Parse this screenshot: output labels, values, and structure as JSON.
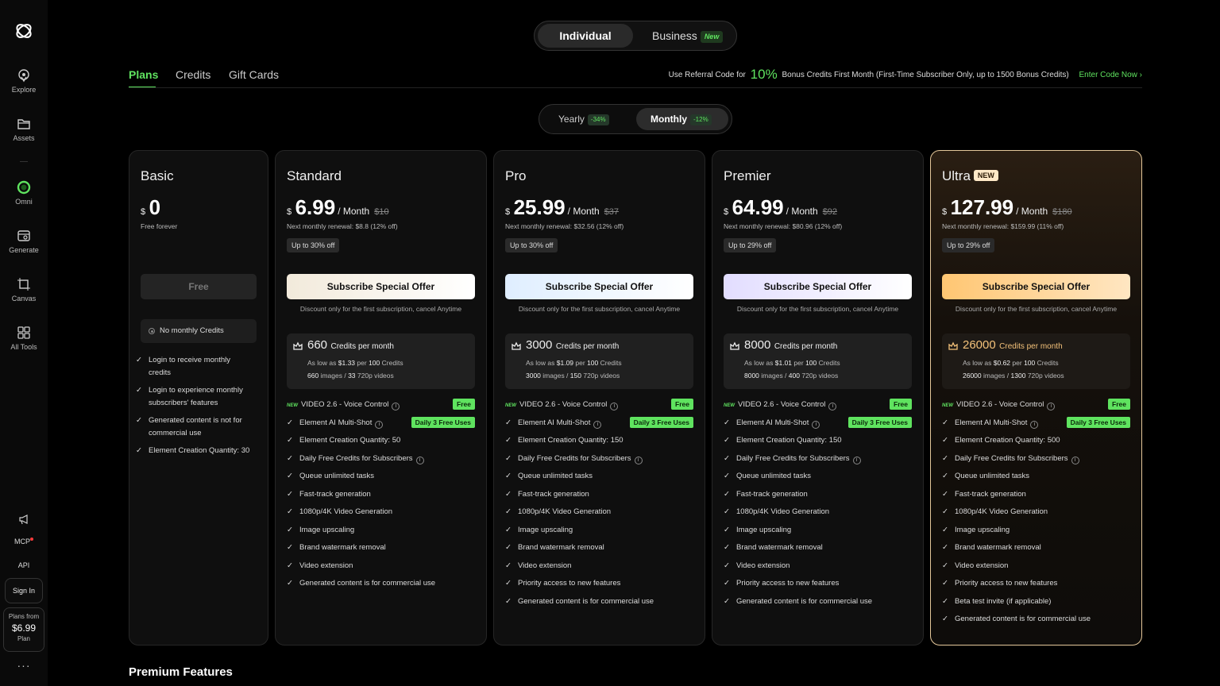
{
  "sidebar": {
    "items": [
      {
        "label": "Explore",
        "icon": "explore-icon"
      },
      {
        "label": "Assets",
        "icon": "folder-icon"
      },
      {
        "label": "Omni",
        "icon": "omni-icon"
      },
      {
        "label": "Generate",
        "icon": "generate-icon"
      },
      {
        "label": "Canvas",
        "icon": "canvas-icon"
      },
      {
        "label": "All Tools",
        "icon": "grid-icon"
      }
    ],
    "mcp": "MCP",
    "api": "API",
    "sign_in": "Sign In",
    "plans_from": {
      "label": "Plans from",
      "price": "$6.99",
      "suffix": "Plan"
    },
    "more": "···"
  },
  "top_switch": {
    "individual": "Individual",
    "business": "Business",
    "new_badge": "New"
  },
  "tabs": [
    "Plans",
    "Credits",
    "Gift Cards"
  ],
  "referral": {
    "prefix": "Use Referral Code for",
    "percent": "10%",
    "suffix": "Bonus Credits First Month (First-Time Subscriber Only, up to 1500 Bonus Credits)",
    "link": "Enter Code Now"
  },
  "billing": {
    "yearly": "Yearly",
    "yearly_badge": "-34%",
    "monthly": "Monthly",
    "monthly_badge": "-12%"
  },
  "cta_note": "Discount only for the first subscription, cancel Anytime",
  "basic": {
    "name": "Basic",
    "currency": "$",
    "price": "0",
    "sub": "Free forever",
    "button": "Free",
    "no_monthly": "No monthly Credits",
    "features": [
      "Login to receive monthly credits",
      "Login to experience monthly subscribers' features",
      "Generated content is not for commercial use",
      "Element Creation Quantity: 30"
    ]
  },
  "plans": [
    {
      "name": "Standard",
      "currency": "$",
      "price": "6.99",
      "unit": "/ Month",
      "old": "$10",
      "renewal": "Next monthly renewal: $8.8 (12% off)",
      "off": "Up to 30% off",
      "button": "Subscribe Special Offer",
      "credits": "660",
      "credits_label": "Credits per month",
      "as_low_as": "As low as",
      "per_price": "$1.33",
      "per": "per",
      "per_qty": "100",
      "per_unit": "Credits",
      "images": "660",
      "images_label": "images /",
      "videos": "33",
      "videos_label": "720p videos",
      "features": [
        {
          "text": "VIDEO 2.6 - Voice Control",
          "new": "NEW",
          "info": true,
          "badge": "Free"
        },
        {
          "text": "Element AI Multi-Shot",
          "info": true,
          "badge": "Daily 3 Free Uses"
        },
        {
          "text": "Element Creation Quantity: 50"
        },
        {
          "text": "Daily Free Credits for Subscribers",
          "info": true
        },
        {
          "text": "Queue unlimited tasks"
        },
        {
          "text": "Fast-track generation"
        },
        {
          "text": "1080p/4K Video Generation"
        },
        {
          "text": "Image upscaling"
        },
        {
          "text": "Brand watermark removal"
        },
        {
          "text": "Video extension"
        },
        {
          "text": "Generated content is for commercial use"
        }
      ]
    },
    {
      "name": "Pro",
      "currency": "$",
      "price": "25.99",
      "unit": "/ Month",
      "old": "$37",
      "renewal": "Next monthly renewal: $32.56 (12% off)",
      "off": "Up to 30% off",
      "button": "Subscribe Special Offer",
      "credits": "3000",
      "credits_label": "Credits per month",
      "as_low_as": "As low as",
      "per_price": "$1.09",
      "per": "per",
      "per_qty": "100",
      "per_unit": "Credits",
      "images": "3000",
      "images_label": "images /",
      "videos": "150",
      "videos_label": "720p videos",
      "features": [
        {
          "text": "VIDEO 2.6 - Voice Control",
          "new": "NEW",
          "info": true,
          "badge": "Free"
        },
        {
          "text": "Element AI Multi-Shot",
          "info": true,
          "badge": "Daily 3 Free Uses"
        },
        {
          "text": "Element Creation Quantity: 150"
        },
        {
          "text": "Daily Free Credits for Subscribers",
          "info": true
        },
        {
          "text": "Queue unlimited tasks"
        },
        {
          "text": "Fast-track generation"
        },
        {
          "text": "1080p/4K Video Generation"
        },
        {
          "text": "Image upscaling"
        },
        {
          "text": "Brand watermark removal"
        },
        {
          "text": "Video extension"
        },
        {
          "text": "Priority access to new features"
        },
        {
          "text": "Generated content is for commercial use"
        }
      ]
    },
    {
      "name": "Premier",
      "currency": "$",
      "price": "64.99",
      "unit": "/ Month",
      "old": "$92",
      "renewal": "Next monthly renewal: $80.96 (12% off)",
      "off": "Up to 29% off",
      "button": "Subscribe Special Offer",
      "credits": "8000",
      "credits_label": "Credits per month",
      "as_low_as": "As low as",
      "per_price": "$1.01",
      "per": "per",
      "per_qty": "100",
      "per_unit": "Credits",
      "images": "8000",
      "images_label": "images /",
      "videos": "400",
      "videos_label": "720p videos",
      "features": [
        {
          "text": "VIDEO 2.6 - Voice Control",
          "new": "NEW",
          "info": true,
          "badge": "Free"
        },
        {
          "text": "Element AI Multi-Shot",
          "info": true,
          "badge": "Daily 3 Free Uses"
        },
        {
          "text": "Element Creation Quantity: 150"
        },
        {
          "text": "Daily Free Credits for Subscribers",
          "info": true
        },
        {
          "text": "Queue unlimited tasks"
        },
        {
          "text": "Fast-track generation"
        },
        {
          "text": "1080p/4K Video Generation"
        },
        {
          "text": "Image upscaling"
        },
        {
          "text": "Brand watermark removal"
        },
        {
          "text": "Video extension"
        },
        {
          "text": "Priority access to new features"
        },
        {
          "text": "Generated content is for commercial use"
        }
      ]
    },
    {
      "name": "Ultra",
      "new_badge": "NEW",
      "currency": "$",
      "price": "127.99",
      "unit": "/ Month",
      "old": "$180",
      "renewal": "Next monthly renewal: $159.99 (11% off)",
      "off": "Up to 29% off",
      "button": "Subscribe Special Offer",
      "credits": "26000",
      "credits_label": "Credits per month",
      "as_low_as": "As low as",
      "per_price": "$0.62",
      "per": "per",
      "per_qty": "100",
      "per_unit": "Credits",
      "images": "26000",
      "images_label": "images /",
      "videos": "1300",
      "videos_label": "720p videos",
      "features": [
        {
          "text": "VIDEO 2.6 - Voice Control",
          "new": "NEW",
          "info": true,
          "badge": "Free"
        },
        {
          "text": "Element AI Multi-Shot",
          "info": true,
          "badge": "Daily 3 Free Uses"
        },
        {
          "text": "Element Creation Quantity: 500"
        },
        {
          "text": "Daily Free Credits for Subscribers",
          "info": true
        },
        {
          "text": "Queue unlimited tasks"
        },
        {
          "text": "Fast-track generation"
        },
        {
          "text": "1080p/4K Video Generation"
        },
        {
          "text": "Image upscaling"
        },
        {
          "text": "Brand watermark removal"
        },
        {
          "text": "Video extension"
        },
        {
          "text": "Priority access to new features"
        },
        {
          "text": "Beta test invite (if applicable)"
        },
        {
          "text": "Generated content is for commercial use"
        }
      ]
    }
  ],
  "button_gradients": [
    "#f2eadb",
    "#dfeeff",
    "#e2ddff",
    "#ffc672"
  ],
  "accent_green": "#5fe35f",
  "premium_title": "Premium Features"
}
